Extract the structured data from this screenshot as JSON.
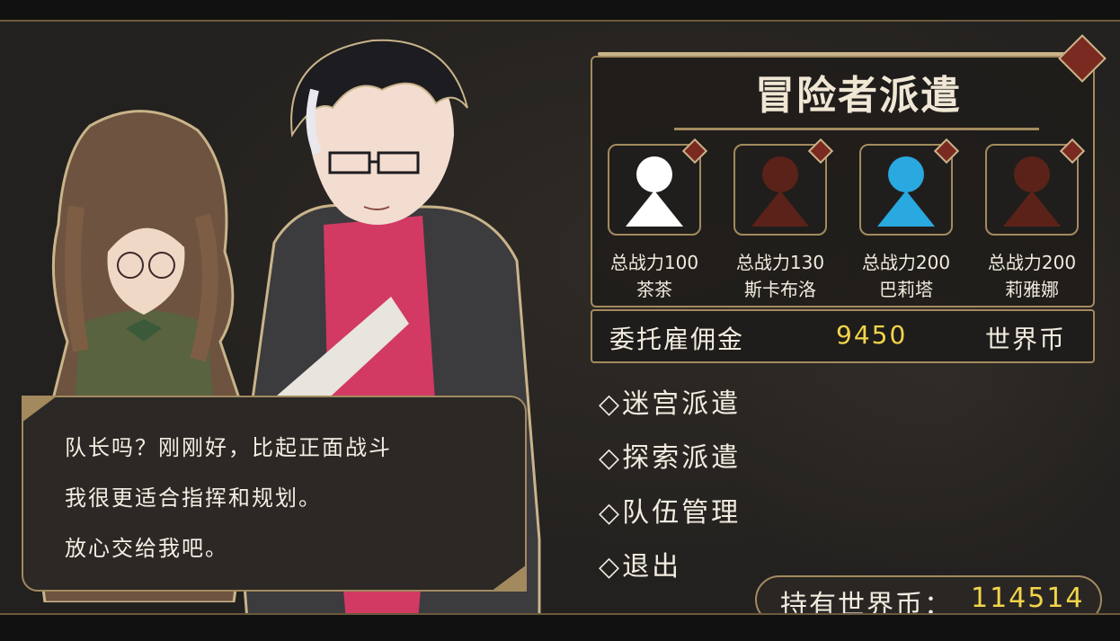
{
  "panel": {
    "title": "冒险者派遣"
  },
  "adventurers": [
    {
      "power": "总战力100",
      "name": "茶茶",
      "icon": "white-person-icon",
      "color": "#ffffff"
    },
    {
      "power": "总战力130",
      "name": "斯卡布洛",
      "icon": "brown-person-icon",
      "color": "#5a2219"
    },
    {
      "power": "总战力200",
      "name": "巴莉塔",
      "icon": "blue-person-icon",
      "color": "#2aa8e0"
    },
    {
      "power": "总战力200",
      "name": "莉雅娜",
      "icon": "brown-person-icon",
      "color": "#5a2219"
    }
  ],
  "fee": {
    "label": "委托雇佣金",
    "value": "9450",
    "unit": "世界币"
  },
  "menu": [
    {
      "label": "◇迷宫派遣"
    },
    {
      "label": "◇探索派遣"
    },
    {
      "label": "◇队伍管理"
    },
    {
      "label": "◇退出"
    }
  ],
  "wallet": {
    "label": "持有世界币：",
    "value": "114514"
  },
  "dialog": {
    "lines": [
      "队长吗？刚刚好，比起正面战斗",
      "我很更适合指挥和规划。",
      "放心交给我吧。"
    ]
  },
  "colors": {
    "accent_gold": "#a38a5e",
    "value_yellow": "#f2d44a",
    "diamond_red": "#7a2a20"
  }
}
